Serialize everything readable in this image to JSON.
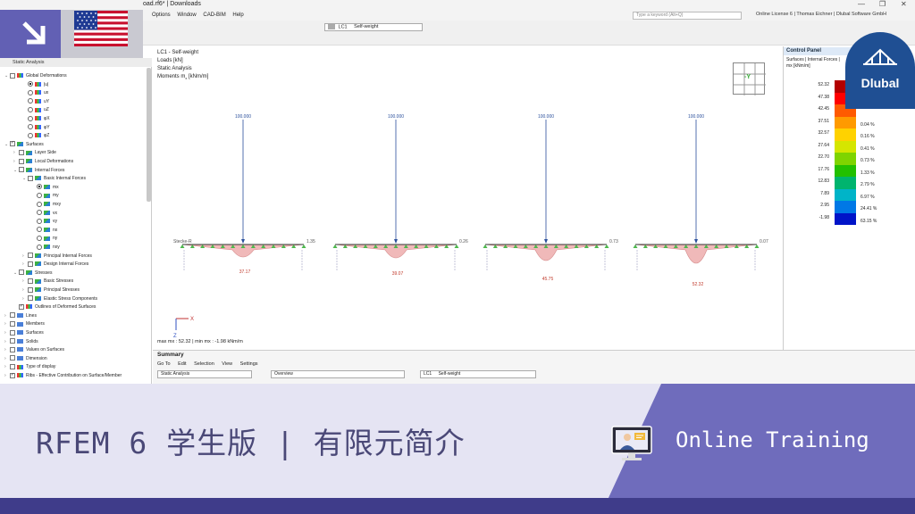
{
  "window": {
    "title": "oad.rf6* | Downloads",
    "license": "Online License 6 | Thomas Eichner | Dlubal Software GmbH"
  },
  "menu": [
    "Options",
    "Window",
    "CAD-BIM",
    "Help"
  ],
  "search": {
    "placeholder": "Type a keyword (Alt+Q)"
  },
  "toolbar": {
    "load_case_code": "LC1",
    "load_case_name": "Self-weight"
  },
  "navigator": {
    "title": "Static Analysis",
    "items": [
      {
        "label": "Global Deformations",
        "indent": 0,
        "kind": "check",
        "on": false,
        "exp": "v",
        "icon": "multi"
      },
      {
        "label": "|u|",
        "indent": 2,
        "kind": "radio",
        "on": true,
        "icon": "multi"
      },
      {
        "label": "ux",
        "indent": 2,
        "kind": "radio",
        "on": false,
        "icon": "multi"
      },
      {
        "label": "uY",
        "indent": 2,
        "kind": "radio",
        "on": false,
        "icon": "multi"
      },
      {
        "label": "uZ",
        "indent": 2,
        "kind": "radio",
        "on": false,
        "icon": "multi"
      },
      {
        "label": "φX",
        "indent": 2,
        "kind": "radio",
        "on": false,
        "icon": "multi"
      },
      {
        "label": "φY",
        "indent": 2,
        "kind": "radio",
        "on": false,
        "icon": "multi"
      },
      {
        "label": "φZ",
        "indent": 2,
        "kind": "radio",
        "on": false,
        "icon": "multi"
      },
      {
        "label": "Surfaces",
        "indent": 0,
        "kind": "check",
        "on": true,
        "exp": "v",
        "icon": "green"
      },
      {
        "label": "Layer Side",
        "indent": 1,
        "kind": "check",
        "on": false,
        "exp": ">",
        "icon": "green"
      },
      {
        "label": "Local Deformations",
        "indent": 1,
        "kind": "check",
        "on": false,
        "exp": ">",
        "icon": "green"
      },
      {
        "label": "Internal Forces",
        "indent": 1,
        "kind": "check",
        "on": false,
        "exp": "v",
        "icon": "green"
      },
      {
        "label": "Basic Internal Forces",
        "indent": 2,
        "kind": "check",
        "on": false,
        "exp": "v",
        "icon": "green"
      },
      {
        "label": "mx",
        "indent": 3,
        "kind": "radio",
        "on": true,
        "icon": "green"
      },
      {
        "label": "my",
        "indent": 3,
        "kind": "radio",
        "on": false,
        "icon": "green"
      },
      {
        "label": "mxy",
        "indent": 3,
        "kind": "radio",
        "on": false,
        "icon": "green"
      },
      {
        "label": "vx",
        "indent": 3,
        "kind": "radio",
        "on": false,
        "icon": "green"
      },
      {
        "label": "vy",
        "indent": 3,
        "kind": "radio",
        "on": false,
        "icon": "green"
      },
      {
        "label": "nx",
        "indent": 3,
        "kind": "radio",
        "on": false,
        "icon": "green"
      },
      {
        "label": "ny",
        "indent": 3,
        "kind": "radio",
        "on": false,
        "icon": "green"
      },
      {
        "label": "nxy",
        "indent": 3,
        "kind": "radio",
        "on": false,
        "icon": "green"
      },
      {
        "label": "Principal Internal Forces",
        "indent": 2,
        "kind": "check",
        "on": false,
        "exp": ">",
        "icon": "green"
      },
      {
        "label": "Design Internal Forces",
        "indent": 2,
        "kind": "check",
        "on": false,
        "exp": ">",
        "icon": "green"
      },
      {
        "label": "Stresses",
        "indent": 1,
        "kind": "check",
        "on": false,
        "exp": "v",
        "icon": "green"
      },
      {
        "label": "Basic Stresses",
        "indent": 2,
        "kind": "check",
        "on": false,
        "exp": ">",
        "icon": "green"
      },
      {
        "label": "Principal Stresses",
        "indent": 2,
        "kind": "check",
        "on": false,
        "exp": ">",
        "icon": "green"
      },
      {
        "label": "Elastic Stress Components",
        "indent": 2,
        "kind": "check",
        "on": false,
        "exp": ">",
        "icon": "green"
      },
      {
        "label": "Outlines of Deformed Surfaces",
        "indent": 1,
        "kind": "check",
        "on": true,
        "icon": "multi"
      },
      {
        "label": "Lines",
        "indent": 0,
        "kind": "check",
        "on": false,
        "exp": ">",
        "icon": "blue"
      },
      {
        "label": "Members",
        "indent": 0,
        "kind": "check",
        "on": false,
        "exp": ">",
        "icon": "blue"
      },
      {
        "label": "Surfaces",
        "indent": 0,
        "kind": "check",
        "on": false,
        "exp": ">",
        "icon": "blue"
      },
      {
        "label": "Solids",
        "indent": 0,
        "kind": "check",
        "on": false,
        "exp": ">",
        "icon": "blue"
      },
      {
        "label": "Values on Surfaces",
        "indent": 0,
        "kind": "check",
        "on": false,
        "exp": ">",
        "icon": "blue"
      },
      {
        "label": "Dimension",
        "indent": 0,
        "kind": "check",
        "on": false,
        "exp": ">",
        "icon": "blue"
      },
      {
        "label": "Type of display",
        "indent": 0,
        "kind": "check",
        "on": false,
        "exp": ">",
        "icon": "multi"
      },
      {
        "label": "Ribs - Effective Contribution on Surface/Member",
        "indent": 0,
        "kind": "check",
        "on": true,
        "exp": ">",
        "icon": "multi"
      }
    ]
  },
  "view": {
    "info_lines": [
      "LC1 - Self-weight",
      "Loads [kN]",
      "Static Analysis"
    ],
    "moments_label": "Moments m",
    "moments_sub": "x",
    "moments_unit": " [kNm/m]",
    "cube_label": "-Y",
    "load_value": "100.000",
    "beams": [
      {
        "load": "100.000",
        "peak": "37.17",
        "left_end": "Stecke-R",
        "right_end": "1.35"
      },
      {
        "load": "100.000",
        "peak": "39.07",
        "left_end": "",
        "right_end": "0.26"
      },
      {
        "load": "100.000",
        "peak": "45.75",
        "left_end": "",
        "right_end": "0.73"
      },
      {
        "load": "100.000",
        "peak": "52.32",
        "left_end": "",
        "right_end": "0.07"
      }
    ],
    "axis_x": "X",
    "axis_z": "Z",
    "maxmin": "max mx : 52.32 | min mx : -1.98 kNm/m"
  },
  "control_panel": {
    "title": "Control Panel",
    "subtitle": "Surfaces | Internal Forces |",
    "quantity": "mx [kNm/m]",
    "legend": [
      {
        "value": "52.32",
        "color": "#b30000",
        "pct": ""
      },
      {
        "value": "47.38",
        "color": "#ff0000",
        "pct": ""
      },
      {
        "value": "42.45",
        "color": "#ff5a00",
        "pct": ""
      },
      {
        "value": "37.51",
        "color": "#ff9a00",
        "pct": "0.04 %"
      },
      {
        "value": "32.57",
        "color": "#ffd200",
        "pct": "0.16 %"
      },
      {
        "value": "27.64",
        "color": "#d5e600",
        "pct": "0.41 %"
      },
      {
        "value": "22.70",
        "color": "#7fd400",
        "pct": "0.73 %"
      },
      {
        "value": "17.76",
        "color": "#22c000",
        "pct": "1.33 %"
      },
      {
        "value": "12.83",
        "color": "#00b46e",
        "pct": "2.79 %"
      },
      {
        "value": "7.89",
        "color": "#00b4c8",
        "pct": "6.97 %"
      },
      {
        "value": "2.95",
        "color": "#0078e6",
        "pct": "24.41 %"
      },
      {
        "value": "-1.98",
        "color": "#0014c8",
        "pct": "63.15 %"
      }
    ]
  },
  "summary": {
    "title": "Summary",
    "menu": [
      "Go To",
      "Edit",
      "Selection",
      "View",
      "Settings"
    ],
    "analysis": "Static Analysis",
    "overview": "Overview",
    "lc_code": "LC1",
    "lc_name": "Self-weight"
  },
  "banner": {
    "title": "RFEM 6 学生版 | 有限元简介",
    "online": "Online Training",
    "logo_text": "Dlubal"
  },
  "colors": {
    "accent": "#6f6cbc",
    "banner_bg": "#e5e4f3",
    "banner_text": "#4a4877",
    "logo_blue": "#1f4f93",
    "diagram_fill": "#f0b9b9",
    "support_green": "#4db84d"
  }
}
